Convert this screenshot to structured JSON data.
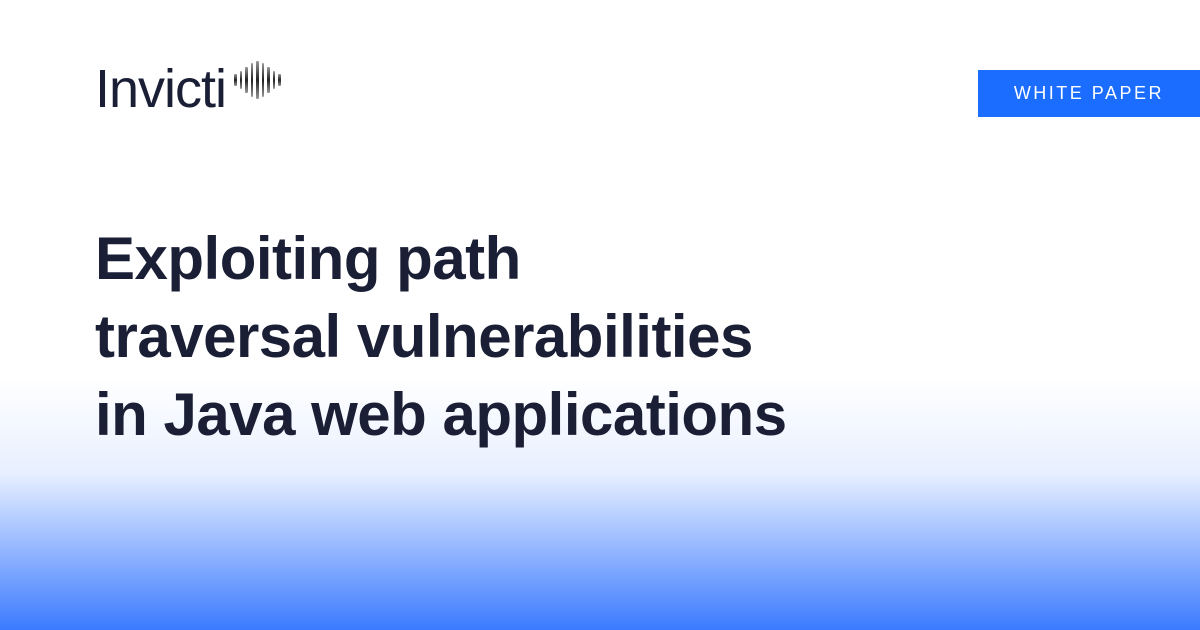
{
  "logo": {
    "text": "Invicti"
  },
  "badge": {
    "label": "WHITE PAPER"
  },
  "title": "Exploiting path\ntraversal vulnerabilities\nin Java web applications"
}
